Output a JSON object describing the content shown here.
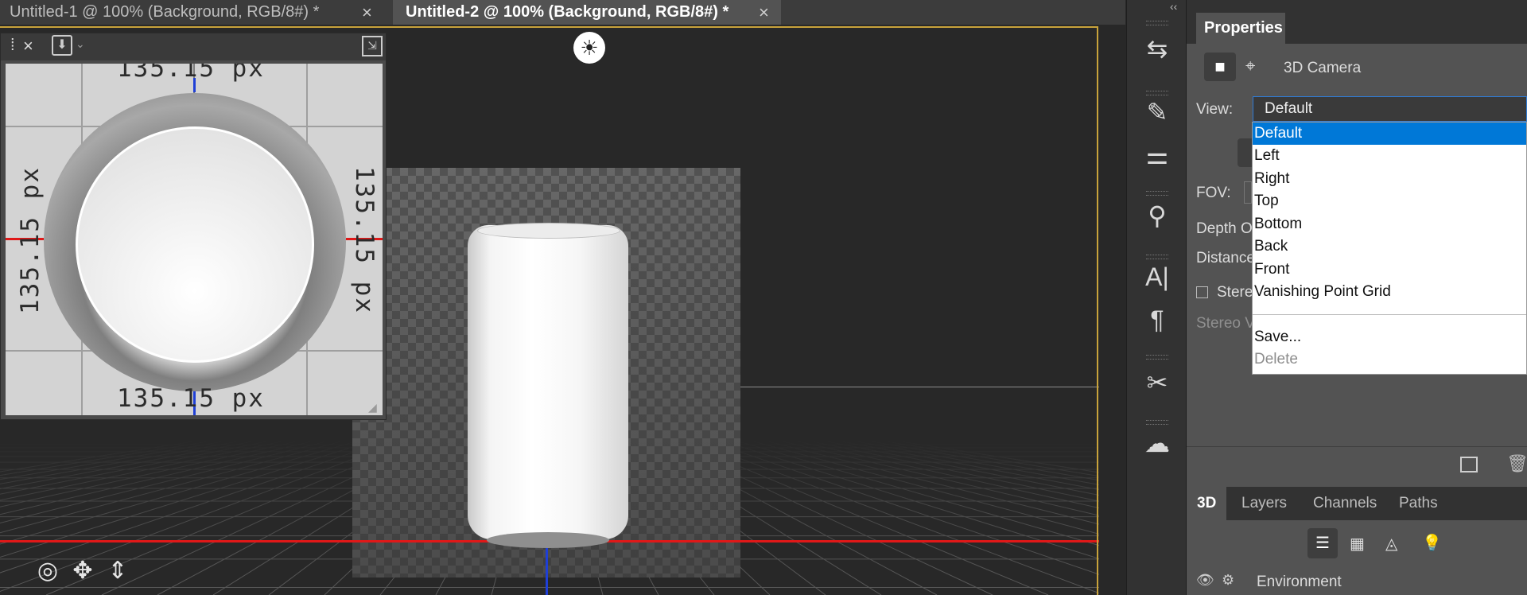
{
  "tabs": [
    {
      "label": "Untitled-1 @ 100% (Background, RGB/8#) *",
      "close": "×"
    },
    {
      "label": "Untitled-2 @ 100% (Background, RGB/8#) *",
      "close": "×"
    }
  ],
  "secondary_view": {
    "dimensions": {
      "top": "135.15 px",
      "bottom": "135.15 px",
      "left": "135.15 px",
      "right": "135.15 px"
    }
  },
  "strip": {
    "collapse": "‹‹"
  },
  "properties": {
    "tab_label": "Properties",
    "type_label": "3D Camera",
    "view_label": "View:",
    "view_value": "Default",
    "fov_label": "FOV:",
    "depth_label": "Depth O",
    "distance_label": "Distance",
    "stereo_label": "Stere",
    "stereo_view_label": "Stereo V",
    "dropdown_options": [
      "Default",
      "Left",
      "Right",
      "Top",
      "Bottom",
      "Back",
      "Front",
      "Vanishing Point Grid"
    ],
    "dropdown_save": "Save...",
    "dropdown_delete": "Delete"
  },
  "lower_panel": {
    "tabs": [
      "3D",
      "Layers",
      "Channels",
      "Paths"
    ],
    "environment_label": "Environment"
  },
  "colors": {
    "accent": "#c9a33b",
    "x_axis": "#e01818",
    "y_axis": "#1f3fd6",
    "selection": "#0078d7"
  }
}
